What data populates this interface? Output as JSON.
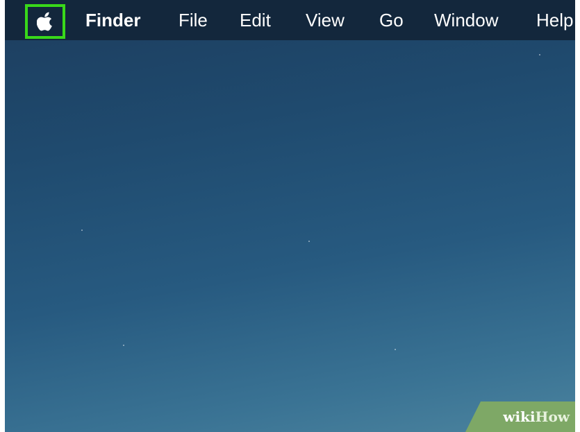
{
  "menubar": {
    "apple_icon": "apple-logo-icon",
    "items": [
      "Finder",
      "File",
      "Edit",
      "View",
      "Go",
      "Window",
      "Help"
    ]
  },
  "highlight_color": "#39d81a",
  "watermark": {
    "part1": "wiki",
    "part2": "How"
  }
}
